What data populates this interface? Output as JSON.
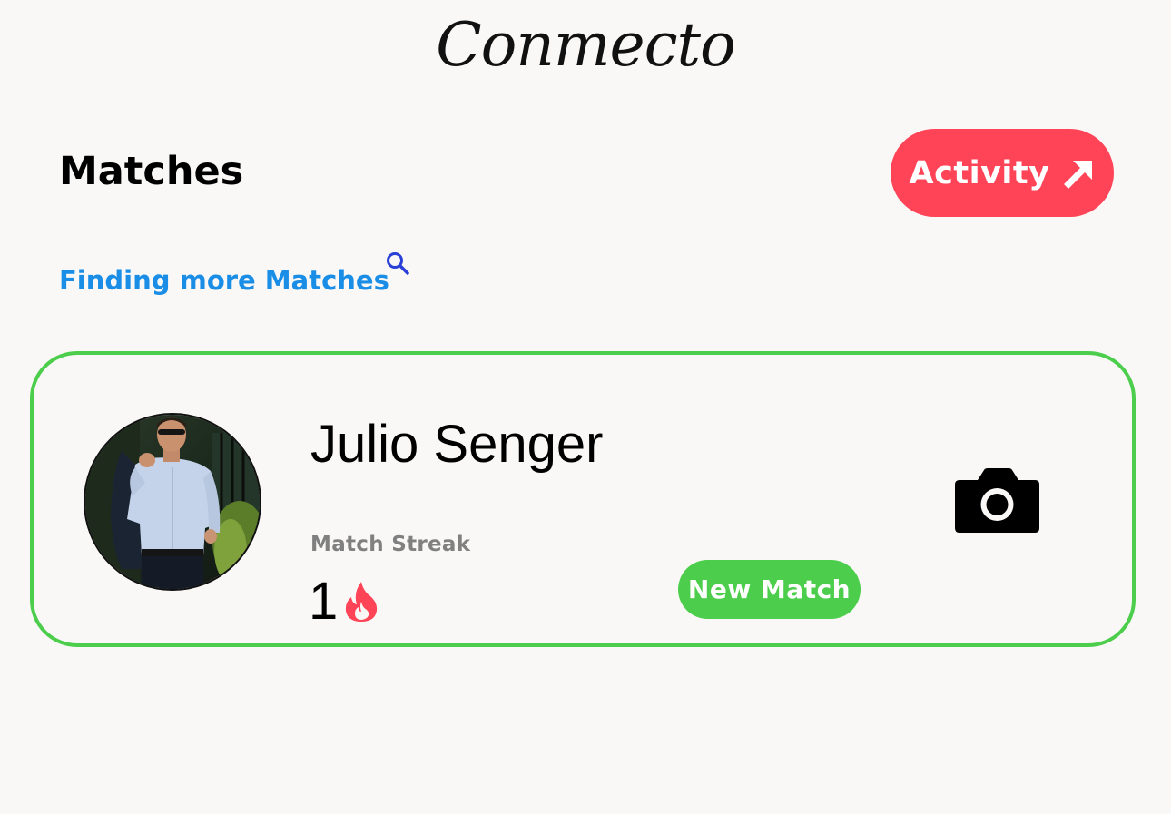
{
  "app": {
    "logo_text": "Conmecto"
  },
  "header": {
    "title": "Matches",
    "activity_button": {
      "label": "Activity",
      "icon": "arrow-up-right-icon",
      "color": "#ff4458"
    }
  },
  "search": {
    "link_text": "Finding more Matches",
    "icon": "search-icon",
    "link_color": "#1a8ee6"
  },
  "matches": [
    {
      "name": "Julio Senger",
      "avatar_icon": "avatar-photo",
      "streak_label": "Match Streak",
      "streak_value": "1",
      "streak_icon": "fire-icon",
      "badge": "New Match",
      "action_icon": "camera-icon",
      "accent_color": "#4cce4c"
    }
  ]
}
